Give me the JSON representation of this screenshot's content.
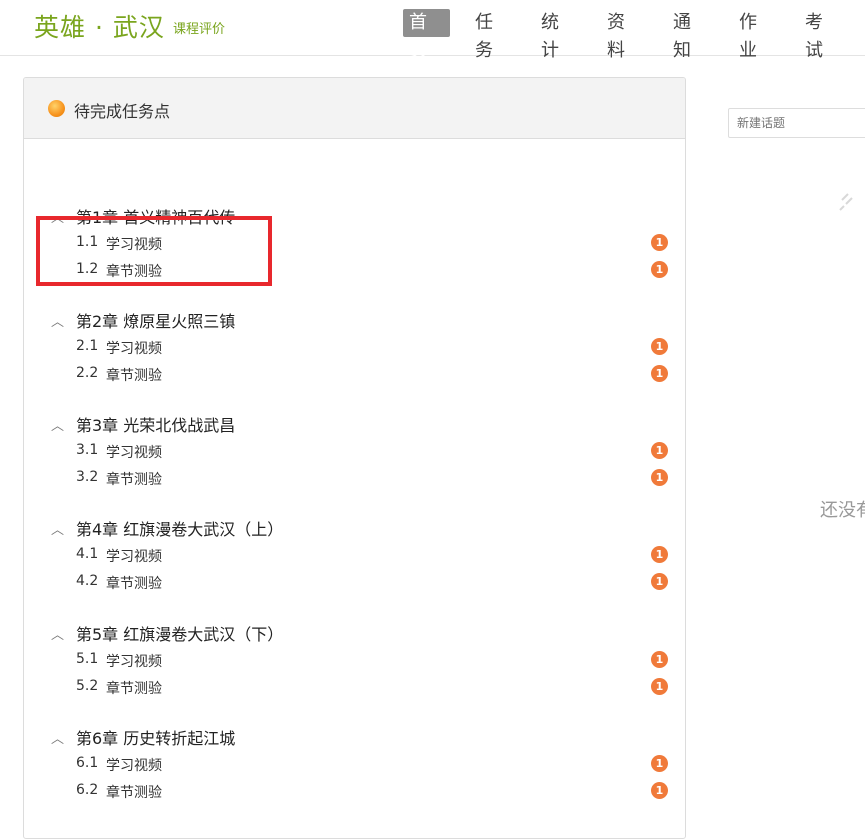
{
  "header": {
    "logo": "英雄 · 武汉",
    "subtitle": "课程评价",
    "nav": [
      "首页",
      "任务",
      "统计",
      "资料",
      "通知",
      "作业",
      "考试"
    ],
    "active_nav": "首页"
  },
  "panel": {
    "title": "待完成任务点",
    "chapters": [
      {
        "title": "第1章 首义精神百代传",
        "items": [
          {
            "no": "1.1",
            "label": "学习视频",
            "badge": "1"
          },
          {
            "no": "1.2",
            "label": "章节测验",
            "badge": "1"
          }
        ]
      },
      {
        "title": "第2章 燎原星火照三镇",
        "items": [
          {
            "no": "2.1",
            "label": "学习视频",
            "badge": "1"
          },
          {
            "no": "2.2",
            "label": "章节测验",
            "badge": "1"
          }
        ]
      },
      {
        "title": "第3章 光荣北伐战武昌",
        "items": [
          {
            "no": "3.1",
            "label": "学习视频",
            "badge": "1"
          },
          {
            "no": "3.2",
            "label": "章节测验",
            "badge": "1"
          }
        ]
      },
      {
        "title": "第4章 红旗漫卷大武汉（上）",
        "items": [
          {
            "no": "4.1",
            "label": "学习视频",
            "badge": "1"
          },
          {
            "no": "4.2",
            "label": "章节测验",
            "badge": "1"
          }
        ]
      },
      {
        "title": "第5章 红旗漫卷大武汉（下）",
        "items": [
          {
            "no": "5.1",
            "label": "学习视频",
            "badge": "1"
          },
          {
            "no": "5.2",
            "label": "章节测验",
            "badge": "1"
          }
        ]
      },
      {
        "title": "第6章 历史转折起江城",
        "items": [
          {
            "no": "6.1",
            "label": "学习视频",
            "badge": "1"
          },
          {
            "no": "6.2",
            "label": "章节测验",
            "badge": "1"
          }
        ]
      }
    ]
  },
  "right": {
    "topic_placeholder": "新建话题",
    "empty_text": "还没有"
  },
  "colors": {
    "brand": "#7aa51e",
    "badge": "#f07a3a",
    "highlight": "#e8282d"
  }
}
